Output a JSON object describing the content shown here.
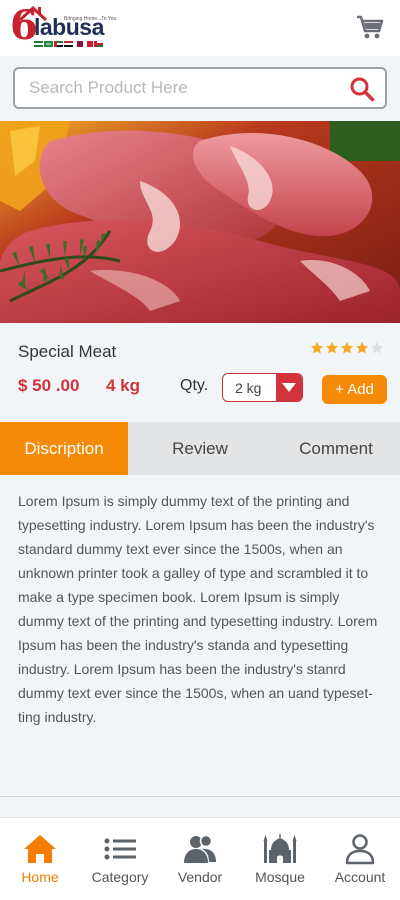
{
  "header": {
    "logo": {
      "text": "labusa",
      "tagline": "Bringing Home...To You",
      "numeral": "6"
    },
    "cart_icon": "cart-icon"
  },
  "search": {
    "placeholder": "Search Product Here",
    "value": "",
    "icon": "search-icon"
  },
  "product": {
    "name": "Special Meat",
    "rating": 4,
    "rating_max": 5,
    "price": "$ 50 .00",
    "weight": "4 kg",
    "qty_label": "Qty.",
    "qty_selected": "2 kg",
    "add_label": "+ Add"
  },
  "tabs": [
    {
      "label": "Discription",
      "active": true
    },
    {
      "label": "Review",
      "active": false
    },
    {
      "label": "Comment",
      "active": false
    }
  ],
  "description": "Lorem Ipsum is simply dummy text of the printing and typesetting industry. Lorem Ipsum has been the industry's standard dummy text ever since the 1500s, when an unknown printer took a galley of type and scrambled it to make a type specimen book. Lorem Ipsum is simply dummy text of the printing and typesetting industry. Lorem Ipsum has been the industry's standa and typesetting industry. Lorem Ipsum has been the industry's stanrd dummy text ever since the 1500s, when an uand typeset-ting industry.",
  "nav": [
    {
      "label": "Home",
      "icon": "home-icon",
      "active": true
    },
    {
      "label": "Category",
      "icon": "list-icon",
      "active": false
    },
    {
      "label": "Vendor",
      "icon": "users-icon",
      "active": false
    },
    {
      "label": "Mosque",
      "icon": "mosque-icon",
      "active": false
    },
    {
      "label": "Account",
      "icon": "user-icon",
      "active": false
    }
  ],
  "colors": {
    "accent": "#f58a07",
    "price": "#d0343a",
    "nav_active": "#f57c00",
    "star": "#f5a623"
  }
}
